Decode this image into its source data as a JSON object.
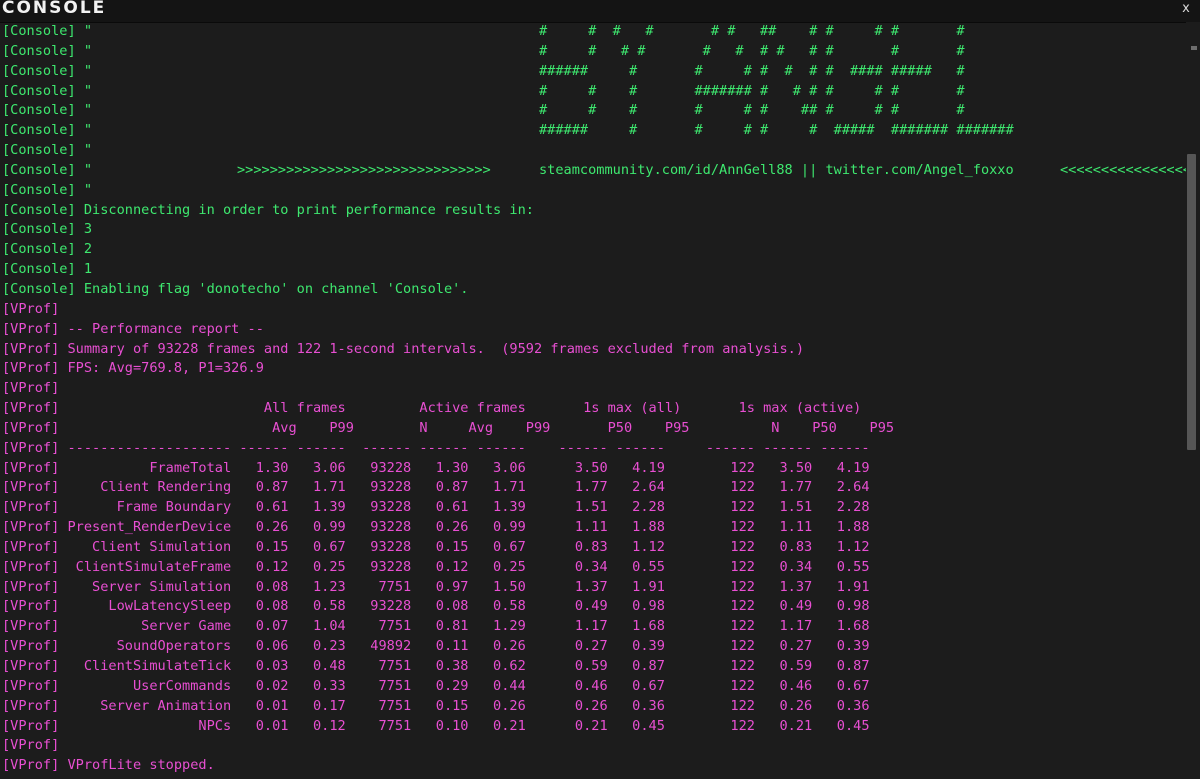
{
  "window": {
    "title": "CONSOLE",
    "close_label": "x"
  },
  "colors": {
    "background": "#1c1c1c",
    "titlebar": "#141414",
    "console_green": "#3ee86f",
    "vprof_magenta": "#e84fd2"
  },
  "lines": [
    {
      "channel": "console",
      "text": "[Console] \"",
      "art": "#     #  #   #       # #   ##    # #     # #       #"
    },
    {
      "channel": "console",
      "text": "[Console] \"",
      "art": "#     #   # #       #   #  # #   # #       #       #"
    },
    {
      "channel": "console",
      "text": "[Console] \"",
      "art": "######     #       #     # #  #  # #  #### #####   #"
    },
    {
      "channel": "console",
      "text": "[Console] \"",
      "art": "#     #    #       ####### #   # # #     # #       #"
    },
    {
      "channel": "console",
      "text": "[Console] \"",
      "art": "#     #    #       #     # #    ## #     # #       #"
    },
    {
      "channel": "console",
      "text": "[Console] \"",
      "art": "######     #       #     # #     #  #####  ####### #######"
    },
    {
      "channel": "console",
      "text": "[Console] \""
    },
    {
      "channel": "console",
      "text": "[Console] \"",
      "arrows": ">>>>>>>>>>>>>>>>>>>>>>>>>>>>>>>",
      "links": "steamcommunity.com/id/AnnGell88 || twitter.com/Angel_foxxo",
      "arrows_right": "<<<<<<<<<<<<<<<<"
    },
    {
      "channel": "console",
      "text": "[Console] \""
    },
    {
      "channel": "console",
      "text": "[Console] Disconnecting in order to print performance results in:"
    },
    {
      "channel": "console",
      "text": "[Console] 3"
    },
    {
      "channel": "console",
      "text": "[Console] 2"
    },
    {
      "channel": "console",
      "text": "[Console] 1"
    },
    {
      "channel": "console",
      "text": "[Console] Enabling flag 'donotecho' on channel 'Console'."
    },
    {
      "channel": "vprof",
      "text": "[VProf]"
    },
    {
      "channel": "vprof",
      "text": "[VProf] -- Performance report --"
    },
    {
      "channel": "vprof",
      "text": "[VProf] Summary of 93228 frames and 122 1-second intervals.  (9592 frames excluded from analysis.)"
    },
    {
      "channel": "vprof",
      "text": "[VProf] FPS: Avg=769.8, P1=326.9"
    },
    {
      "channel": "vprof",
      "text": "[VProf]"
    },
    {
      "channel": "vprof",
      "text": "[VProf]                         All frames         Active frames       1s max (all)       1s max (active)"
    },
    {
      "channel": "vprof",
      "text": "[VProf]                          Avg    P99        N     Avg    P99       P50    P95          N    P50    P95"
    },
    {
      "channel": "vprof",
      "text": "[VProf] -------------------- ------ ------  ------ ------ ------    ------ ------     ------ ------ ------"
    },
    {
      "channel": "vprof",
      "text": "[VProf]           FrameTotal   1.30   3.06   93228   1.30   3.06      3.50   4.19        122   3.50   4.19"
    },
    {
      "channel": "vprof",
      "text": "[VProf]     Client Rendering   0.87   1.71   93228   0.87   1.71      1.77   2.64        122   1.77   2.64"
    },
    {
      "channel": "vprof",
      "text": "[VProf]       Frame Boundary   0.61   1.39   93228   0.61   1.39      1.51   2.28        122   1.51   2.28"
    },
    {
      "channel": "vprof",
      "text": "[VProf] Present_RenderDevice   0.26   0.99   93228   0.26   0.99      1.11   1.88        122   1.11   1.88"
    },
    {
      "channel": "vprof",
      "text": "[VProf]    Client Simulation   0.15   0.67   93228   0.15   0.67      0.83   1.12        122   0.83   1.12"
    },
    {
      "channel": "vprof",
      "text": "[VProf]  ClientSimulateFrame   0.12   0.25   93228   0.12   0.25      0.34   0.55        122   0.34   0.55"
    },
    {
      "channel": "vprof",
      "text": "[VProf]    Server Simulation   0.08   1.23    7751   0.97   1.50      1.37   1.91        122   1.37   1.91"
    },
    {
      "channel": "vprof",
      "text": "[VProf]      LowLatencySleep   0.08   0.58   93228   0.08   0.58      0.49   0.98        122   0.49   0.98"
    },
    {
      "channel": "vprof",
      "text": "[VProf]          Server Game   0.07   1.04    7751   0.81   1.29      1.17   1.68        122   1.17   1.68"
    },
    {
      "channel": "vprof",
      "text": "[VProf]       SoundOperators   0.06   0.23   49892   0.11   0.26      0.27   0.39        122   0.27   0.39"
    },
    {
      "channel": "vprof",
      "text": "[VProf]   ClientSimulateTick   0.03   0.48    7751   0.38   0.62      0.59   0.87        122   0.59   0.87"
    },
    {
      "channel": "vprof",
      "text": "[VProf]         UserCommands   0.02   0.33    7751   0.29   0.44      0.46   0.67        122   0.46   0.67"
    },
    {
      "channel": "vprof",
      "text": "[VProf]     Server Animation   0.01   0.17    7751   0.15   0.26      0.26   0.36        122   0.26   0.36"
    },
    {
      "channel": "vprof",
      "text": "[VProf]                 NPCs   0.01   0.12    7751   0.10   0.21      0.21   0.45        122   0.21   0.45"
    },
    {
      "channel": "vprof",
      "text": "[VProf]"
    },
    {
      "channel": "vprof",
      "text": "[VProf] VProfLite stopped."
    }
  ]
}
